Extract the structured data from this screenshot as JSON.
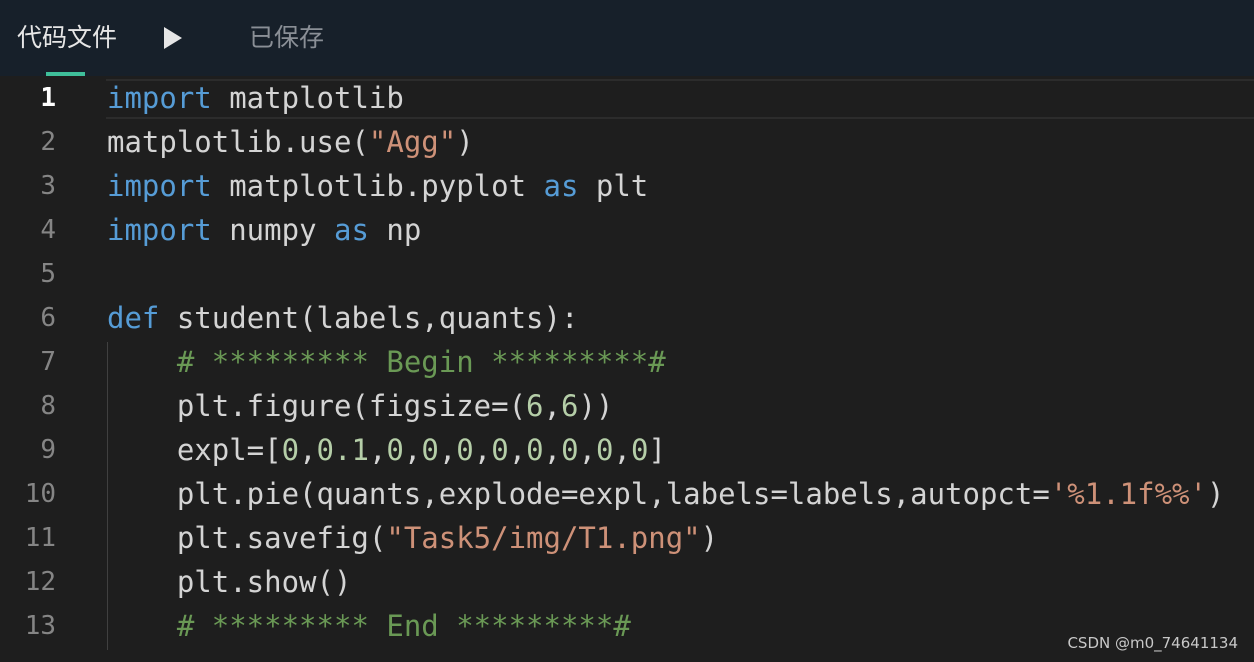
{
  "header": {
    "file_tab_label": "代码文件",
    "run_icon": "play-icon",
    "save_status": "已保存"
  },
  "editor": {
    "active_line": 1,
    "line_numbers": [
      "1",
      "2",
      "3",
      "4",
      "5",
      "6",
      "7",
      "8",
      "9",
      "10",
      "11",
      "12",
      "13"
    ],
    "code_lines": [
      "import matplotlib",
      "matplotlib.use(\"Agg\")",
      "import matplotlib.pyplot as plt",
      "import numpy as np",
      "",
      "def student(labels,quants):",
      "    # ********* Begin *********#",
      "    plt.figure(figsize=(6,6))",
      "    expl=[0,0.1,0,0,0,0,0,0,0,0]",
      "    plt.pie(quants,explode=expl,labels=labels,autopct='%1.1f%%')",
      "    plt.savefig(\"Task5/img/T1.png\")",
      "    plt.show()",
      "    # ********* End *********#"
    ]
  },
  "watermark": "CSDN @m0_74641134",
  "colors": {
    "background": "#1e1e1e",
    "header_background": "#17202a",
    "keyword": "#569cd6",
    "string": "#ce9178",
    "number": "#b5cea8",
    "comment": "#6a9955",
    "tab_underline": "#3fbf9a"
  }
}
